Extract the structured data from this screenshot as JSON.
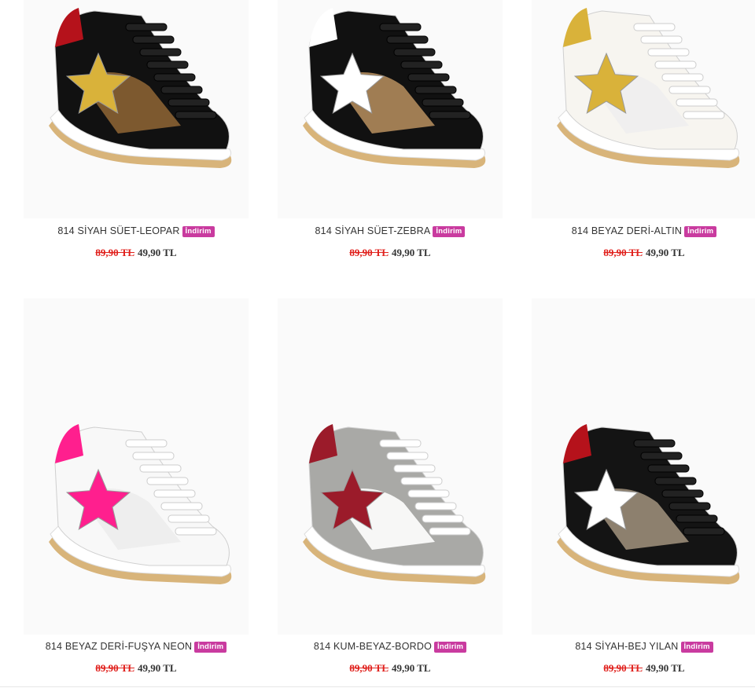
{
  "discount_badge": "İndirim",
  "products": [
    {
      "name": "814 SİYAH SÜET-LEOPAR",
      "old_price": "89,90 TL",
      "new_price": "49,90 TL",
      "colors": {
        "base": "#111111",
        "accent": "#d9b23a",
        "pattern": "#8a6233",
        "collar": "#b5121b",
        "sole": "#d8b47a"
      }
    },
    {
      "name": "814 SİYAH SÜET-ZEBRA",
      "old_price": "89,90 TL",
      "new_price": "49,90 TL",
      "colors": {
        "base": "#111111",
        "accent": "#ffffff",
        "pattern": "#b08a5b",
        "collar": "#ffffff",
        "sole": "#d8b47a"
      }
    },
    {
      "name": "814 BEYAZ DERİ-ALTIN",
      "old_price": "89,90 TL",
      "new_price": "49,90 TL",
      "colors": {
        "base": "#f7f5f0",
        "accent": "#d9b23a",
        "pattern": "#eeeeee",
        "collar": "#d9b23a",
        "sole": "#d8b47a"
      }
    },
    {
      "name": "814 BEYAZ DERİ-FUŞYA NEON",
      "old_price": "89,90 TL",
      "new_price": "49,90 TL",
      "colors": {
        "base": "#f8f8f8",
        "accent": "#ff1f8e",
        "pattern": "#ececec",
        "collar": "#ff1f8e",
        "sole": "#d8b47a"
      }
    },
    {
      "name": "814 KUM-BEYAZ-BORDO",
      "old_price": "89,90 TL",
      "new_price": "49,90 TL",
      "colors": {
        "base": "#a9a9a6",
        "accent": "#9b1b2a",
        "pattern": "#ffffff",
        "collar": "#9b1b2a",
        "sole": "#d8b47a"
      }
    },
    {
      "name": "814 SİYAH-BEJ YILAN",
      "old_price": "89,90 TL",
      "new_price": "49,90 TL",
      "colors": {
        "base": "#141414",
        "accent": "#ffffff",
        "pattern": "#9a8c78",
        "collar": "#b5121b",
        "sole": "#d8b47a"
      }
    }
  ]
}
